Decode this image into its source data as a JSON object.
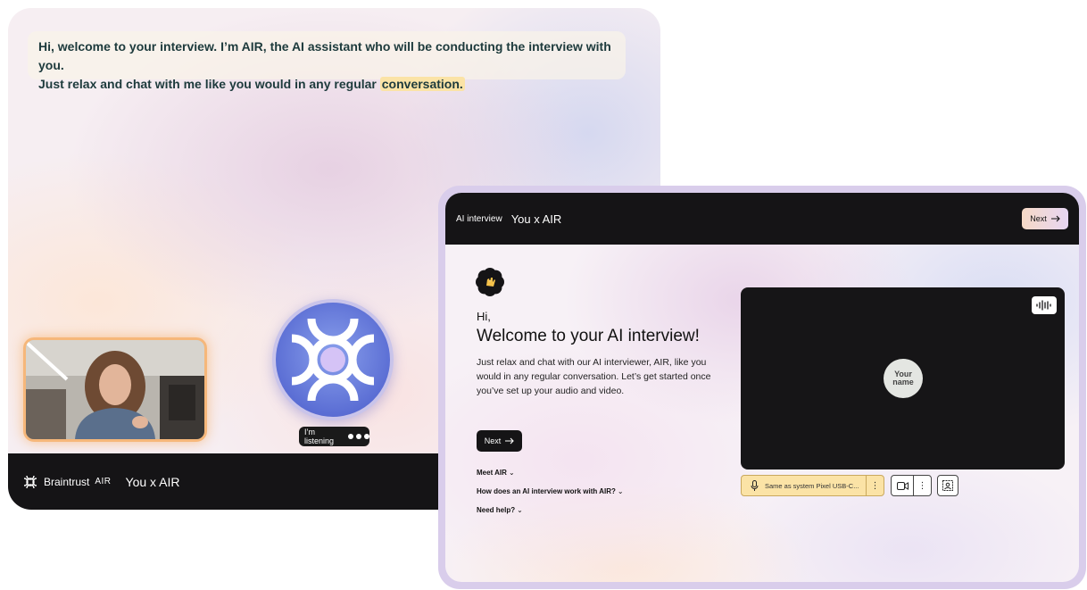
{
  "back_window": {
    "transcript_line1": "Hi, welcome to your interview.  I’m AIR, the AI assistant who will be conducting the interview with you.",
    "transcript_line2_prefix": "Just relax and chat with me like you would in any regular ",
    "transcript_highlight": "conversation.",
    "listening_label": "I’m listening",
    "brand_name": "Braintrust",
    "brand_suffix": "AIR",
    "title": "You x AIR"
  },
  "front_window": {
    "topbar": {
      "section_label": "AI interview",
      "title": "You x AIR",
      "next_label": "Next"
    },
    "greeting": "Hi,",
    "heading": "Welcome to your AI interview!",
    "description": "Just relax and chat with our AI interviewer, AIR, like you would in any regular conversation. Let’s get started once you’ve set up your audio and video.",
    "next_label": "Next",
    "links": [
      {
        "label": "Meet AIR"
      },
      {
        "label": "How does an AI interview work with AIR?"
      },
      {
        "label": "Need help?"
      }
    ],
    "video": {
      "avatar_label": "Your name"
    },
    "audio_device": "Same as system Pixel USB-C..."
  },
  "colors": {
    "dark": "#151416",
    "highlight": "#fbe3a6",
    "frame": "#d9cdeb",
    "orb": "#5b6ed4"
  },
  "icons": [
    "braintrust-logo-icon",
    "audio-wave-icon",
    "microphone-icon",
    "camera-icon",
    "background-icon",
    "arrow-right-icon",
    "chevron-down-icon",
    "more-vertical-icon",
    "waving-hand-icon"
  ]
}
